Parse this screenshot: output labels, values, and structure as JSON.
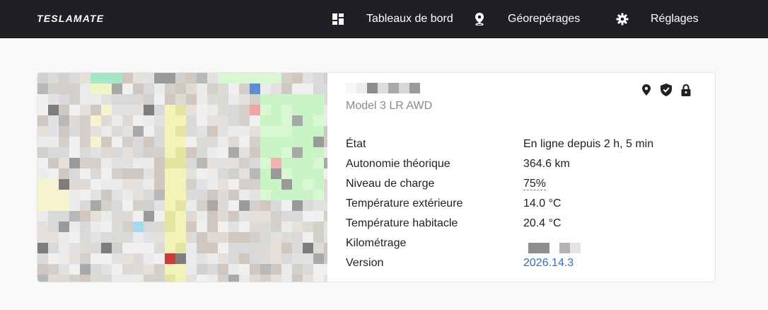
{
  "nav": {
    "brand": "TESLAMATE",
    "items": [
      {
        "label": "Tableaux de bord",
        "icon": "dashboard-icon"
      },
      {
        "label": "Géorepérages",
        "icon": "map-pin-icon"
      },
      {
        "label": "Réglages",
        "icon": "gear-icon"
      }
    ]
  },
  "car": {
    "model": "Model 3 LR AWD",
    "status_icons": [
      "location-pin-icon",
      "shield-check-icon",
      "lock-icon"
    ],
    "details": [
      {
        "label": "État",
        "value": "En ligne depuis 2 h, 5 min"
      },
      {
        "label": "Autonomie théorique",
        "value": "364.6 km"
      },
      {
        "label": "Niveau de charge",
        "value": "75%"
      },
      {
        "label": "Température extérieure",
        "value": "14.0 °C"
      },
      {
        "label": "Température habitacle",
        "value": "20.4 °C"
      },
      {
        "label": "Kilométrage",
        "value": ""
      },
      {
        "label": "Version",
        "value": "2026.14.3"
      }
    ]
  },
  "colors": {
    "nav_bg": "#1e2024",
    "link": "#2f6fd6",
    "muted_text": "#8a8a8a"
  }
}
